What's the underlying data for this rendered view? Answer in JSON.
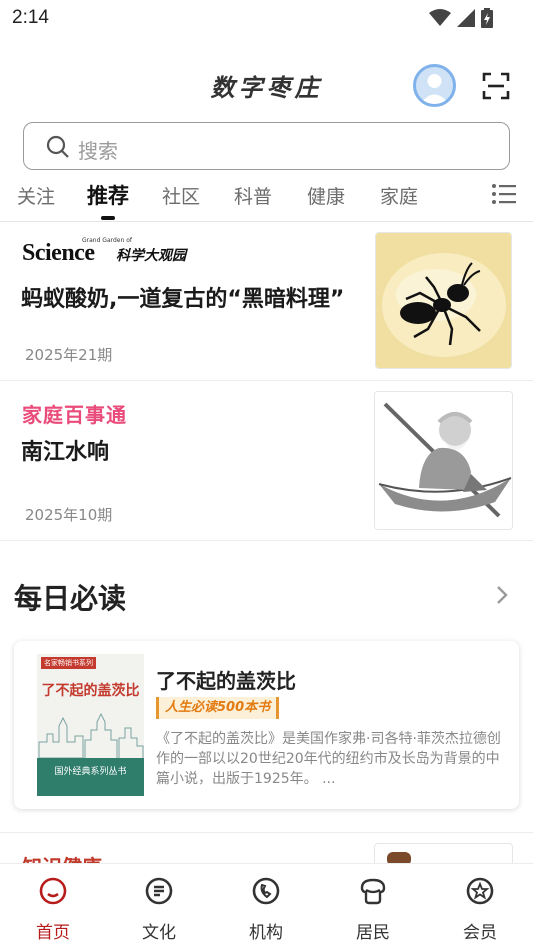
{
  "status_bar": {
    "time": "2:14"
  },
  "header": {
    "title": "数字枣庄"
  },
  "search": {
    "placeholder": "搜索"
  },
  "tabs": [
    {
      "label": "关注",
      "active": false
    },
    {
      "label": "推荐",
      "active": true
    },
    {
      "label": "社区",
      "active": false
    },
    {
      "label": "科普",
      "active": false
    },
    {
      "label": "健康",
      "active": false
    },
    {
      "label": "家庭",
      "active": false
    }
  ],
  "articles": [
    {
      "source_logo": "Science",
      "source_logo_tagline": "科学大观园",
      "source_logo_small": "Grand Garden of",
      "title": "蚂蚁酸奶,一道复古的“黑暗料理”",
      "issue": "2025年21期"
    },
    {
      "source_logo": "家庭百事通",
      "title": "南江水响",
      "issue": "2025年10期"
    }
  ],
  "daily_read": {
    "section_title": "每日必读",
    "book": {
      "title": "了不起的盖茨比",
      "tag": "人生必读500本书",
      "description": "《了不起的盖茨比》是美国作家弗·司各特·菲茨杰拉德创作的一部以以20世纪20年代的纽约市及长岛为背景的中篇小说，出版于1925年。 ...",
      "cover_title": "了不起的盖茨比",
      "cover_series": "国外经典系列丛书",
      "cover_top": "名家畅销书系列"
    }
  },
  "peek_article": {
    "source_logo": "知识健康"
  },
  "bottom_nav": [
    {
      "label": "首页",
      "icon": "home-icon",
      "active": true
    },
    {
      "label": "文化",
      "icon": "culture-icon",
      "active": false
    },
    {
      "label": "机构",
      "icon": "phone-icon",
      "active": false
    },
    {
      "label": "居民",
      "icon": "residents-icon",
      "active": false
    },
    {
      "label": "会员",
      "icon": "member-icon",
      "active": false
    }
  ],
  "colors": {
    "accent_red": "#b71c1c",
    "brand_pink": "#e94b7b",
    "tag_orange": "#e27b12"
  }
}
